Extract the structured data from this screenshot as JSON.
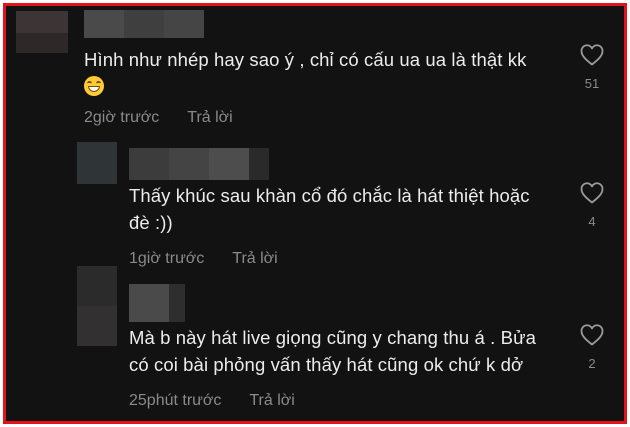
{
  "comments": [
    {
      "text": "Hình như nhép hay sao ý , chỉ có cấu ua ua là thật kk",
      "emoji": "grinning-face-emoji",
      "time": "2giờ trước",
      "reply_label": "Trả lời",
      "likes": "51"
    },
    {
      "text_line1": "Thấy khúc sau khàn cổ đó chắc là hát thiệt hoặc",
      "text_line2": "đè :))",
      "time": "1giờ trước",
      "reply_label": "Trả lời",
      "likes": "4"
    },
    {
      "text_line1": "Mà b này hát live giọng cũng y chang thu á . Bửa",
      "text_line2": "có coi bài phỏng vấn thấy hát cũng ok chứ k dở",
      "time": "25phút trước",
      "reply_label": "Trả lời",
      "likes": "2"
    }
  ],
  "colors": {
    "frame_border": "#e3121b",
    "background": "#121212",
    "text": "#ececec",
    "muted": "#8a8a8a"
  }
}
